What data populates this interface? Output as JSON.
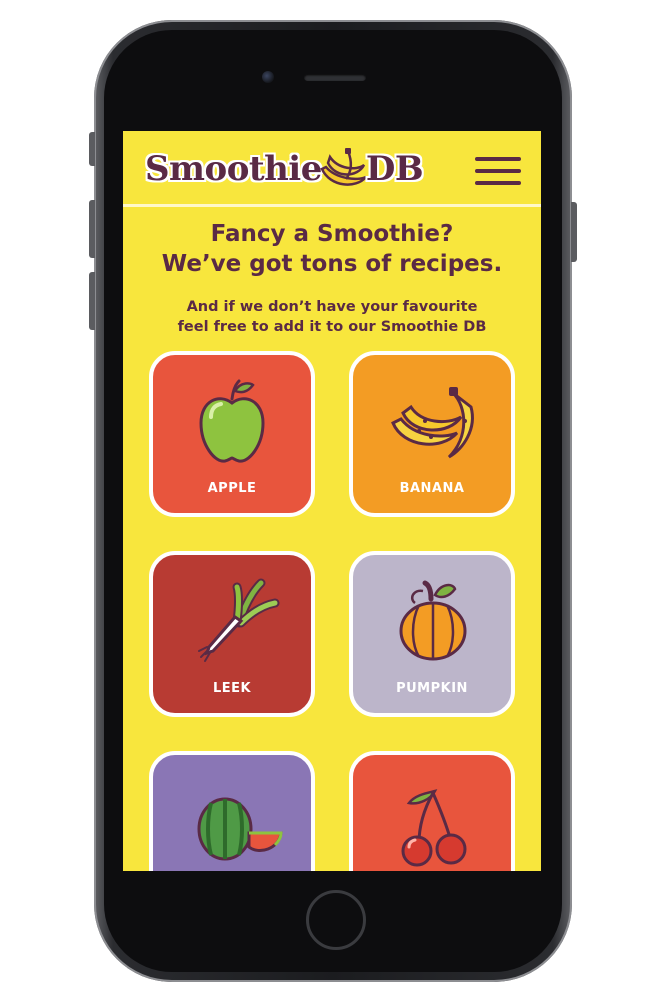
{
  "header": {
    "logo_left": "Smoothie",
    "logo_right": "DB",
    "menu_icon": "hamburger-menu-icon"
  },
  "intro": {
    "headline_line1": "Fancy a Smoothie?",
    "headline_line2": "We’ve got tons of recipes.",
    "sub_line1": "And if we don’t have your favourite",
    "sub_line2": "feel free to add it to our Smoothie DB"
  },
  "colors": {
    "background": "#f8e63d",
    "text": "#5a2a45",
    "apple": "#e8553d",
    "banana": "#f39c24",
    "leek": "#b83b33",
    "pumpkin": "#bcb5ca",
    "watermelon": "#8a76b5",
    "cherry": "#e8553d"
  },
  "fruits": [
    {
      "label": "APPLE",
      "icon": "apple-icon"
    },
    {
      "label": "BANANA",
      "icon": "banana-icon"
    },
    {
      "label": "LEEK",
      "icon": "leek-icon"
    },
    {
      "label": "PUMPKIN",
      "icon": "pumpkin-icon"
    },
    {
      "label": "",
      "icon": "watermelon-icon"
    },
    {
      "label": "",
      "icon": "cherry-icon"
    }
  ]
}
